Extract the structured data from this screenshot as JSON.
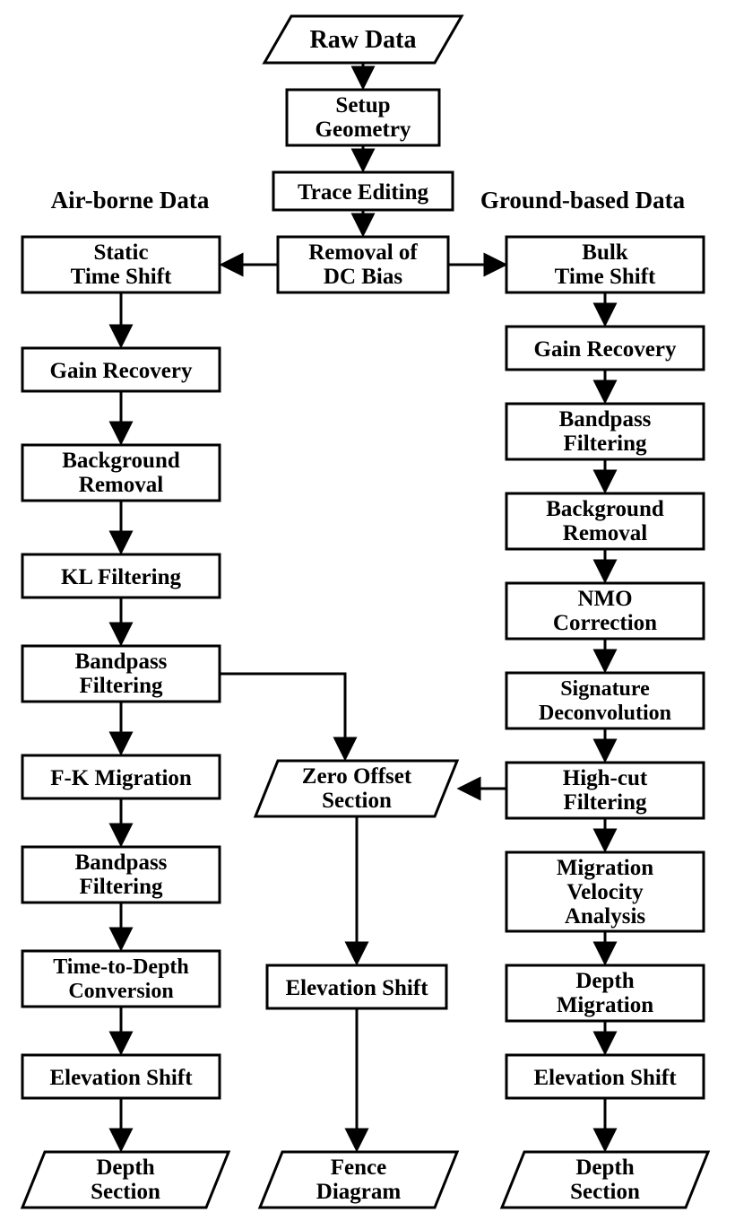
{
  "title_left": "Air-borne Data",
  "title_right": "Ground-based Data",
  "top": {
    "raw": "Raw Data",
    "setup1": "Setup",
    "setup2": "Geometry",
    "trace": "Trace Editing",
    "dc1": "Removal of",
    "dc2": "DC Bias"
  },
  "left": {
    "static1": "Static",
    "static2": "Time Shift",
    "gain": "Gain Recovery",
    "bg1": "Background",
    "bg2": "Removal",
    "kl": "KL Filtering",
    "bp1a": "Bandpass",
    "bp1b": "Filtering",
    "fk": "F-K Migration",
    "bp2a": "Bandpass",
    "bp2b": "Filtering",
    "td1": "Time-to-Depth",
    "td2": "Conversion",
    "elev": "Elevation Shift",
    "depth1": "Depth",
    "depth2": "Section"
  },
  "center": {
    "zo1": "Zero Offset",
    "zo2": "Section",
    "elev": "Elevation Shift",
    "fence1": "Fence",
    "fence2": "Diagram"
  },
  "right": {
    "bulk1": "Bulk",
    "bulk2": "Time Shift",
    "gain": "Gain Recovery",
    "bp1a": "Bandpass",
    "bp1b": "Filtering",
    "bg1": "Background",
    "bg2": "Removal",
    "nmo1": "NMO",
    "nmo2": "Correction",
    "sig1": "Signature",
    "sig2": "Deconvolution",
    "hc1": "High-cut",
    "hc2": "Filtering",
    "mva1": "Migration",
    "mva2": "Velocity",
    "mva3": "Analysis",
    "dm1": "Depth",
    "dm2": "Migration",
    "elev": "Elevation Shift",
    "depth1": "Depth",
    "depth2": "Section"
  }
}
